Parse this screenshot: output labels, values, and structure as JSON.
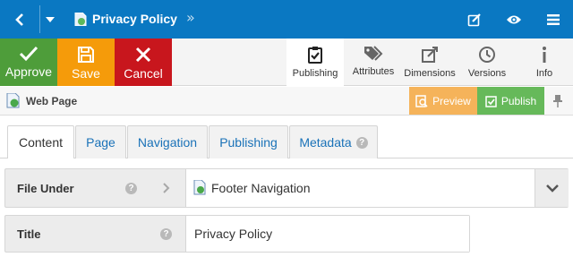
{
  "topbar": {
    "title": "Privacy Policy",
    "breadcrumb_glyph": "»",
    "icons": [
      "back-icon",
      "dropdown-caret-icon",
      "page-icon",
      "edit-icon",
      "view-icon",
      "menu-icon"
    ]
  },
  "actions": {
    "approve": "Approve",
    "save": "Save",
    "cancel": "Cancel"
  },
  "tools": [
    {
      "label": "Publishing",
      "icon": "publishing-icon",
      "active": true
    },
    {
      "label": "Attributes",
      "icon": "tags-icon",
      "active": false
    },
    {
      "label": "Dimensions",
      "icon": "dimensions-icon",
      "active": false
    },
    {
      "label": "Versions",
      "icon": "clock-icon",
      "active": false
    },
    {
      "label": "Info",
      "icon": "info-icon",
      "active": false
    }
  ],
  "subbar": {
    "type_label": "Web Page",
    "preview": "Preview",
    "publish": "Publish"
  },
  "tabs": [
    {
      "label": "Content",
      "active": true
    },
    {
      "label": "Page",
      "active": false
    },
    {
      "label": "Navigation",
      "active": false
    },
    {
      "label": "Publishing",
      "active": false
    },
    {
      "label": "Metadata",
      "active": false
    }
  ],
  "form": {
    "file_under": {
      "label": "File Under",
      "value": "Footer Navigation"
    },
    "title": {
      "label": "Title",
      "value": "Privacy Policy"
    }
  },
  "colors": {
    "topbar": "#0a78c2",
    "approve": "#4e9d3a",
    "save": "#f59b0a",
    "cancel": "#c8161d",
    "preview": "#f5b35a",
    "publish": "#66b95a",
    "link": "#1a72b8"
  }
}
